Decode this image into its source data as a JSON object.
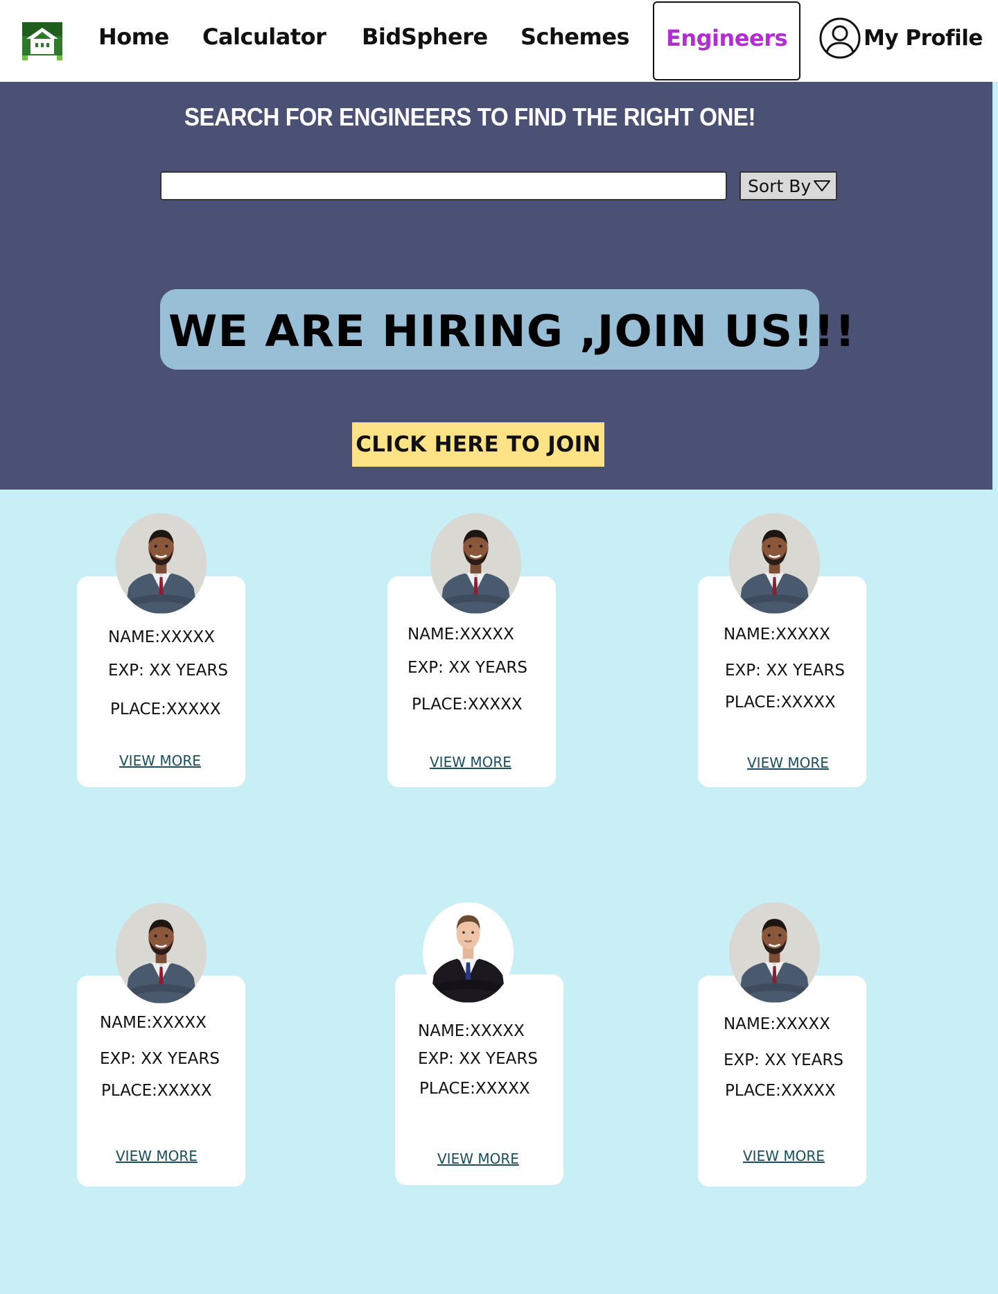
{
  "nav": {
    "logo_icon": "house-logo-icon",
    "links": [
      "Home",
      "Calculator",
      "BidSphere",
      "Schemes"
    ],
    "active_label": "Engineers",
    "active_color": "#b12fd0",
    "profile_icon": "user-circle-icon",
    "profile_label": "My Profile"
  },
  "hero": {
    "title": "SEARCH FOR ENGINEERS TO FIND THE RIGHT ONE!",
    "search_value": "",
    "sort_label": "Sort By",
    "sort_icon": "triangle-down-icon",
    "hiring_text": "WE ARE HIRING ,JOIN US!!!",
    "join_label": "CLICK HERE TO JOIN",
    "background_color": "#4b5075",
    "banner_color": "#98bfd5",
    "join_color": "#fde385"
  },
  "engineers": [
    {
      "name": "NAME:XXXXX",
      "exp": "EXP: XX YEARS",
      "place": "PLACE:XXXXX",
      "link": "VIEW MORE",
      "photo": "engineer-photo-smiling"
    },
    {
      "name": "NAME:XXXXX",
      "exp": "EXP: XX YEARS",
      "place": "PLACE:XXXXX",
      "link": "VIEW MORE",
      "photo": "engineer-photo-smiling"
    },
    {
      "name": "NAME:XXXXX",
      "exp": "EXP: XX YEARS",
      "place": "PLACE:XXXXX",
      "link": "VIEW MORE",
      "photo": "engineer-photo-smiling"
    },
    {
      "name": "NAME:XXXXX",
      "exp": "EXP: XX YEARS",
      "place": "PLACE:XXXXX",
      "link": "VIEW MORE",
      "photo": "engineer-photo-smiling"
    },
    {
      "name": "NAME:XXXXX",
      "exp": "EXP: XX YEARS",
      "place": "PLACE:XXXXX",
      "link": "VIEW MORE",
      "photo": "engineer-photo-dark-suit"
    },
    {
      "name": "NAME:XXXXX",
      "exp": "EXP: XX YEARS",
      "place": "PLACE:XXXXX",
      "link": "VIEW MORE",
      "photo": "engineer-photo-smiling"
    }
  ],
  "colors": {
    "page_background": "#c8eef6",
    "link_color": "#1b4e5c"
  }
}
